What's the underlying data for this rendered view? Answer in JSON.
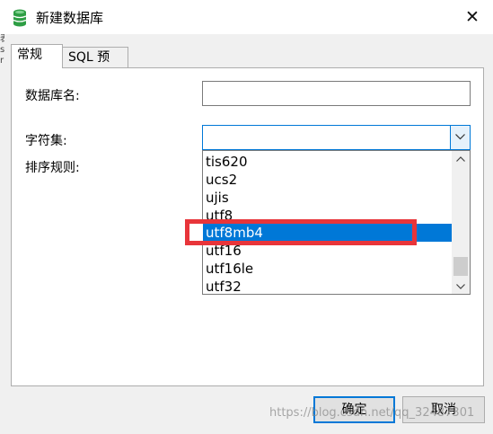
{
  "window": {
    "title": "新建数据库",
    "close_glyph": "✕"
  },
  "left_edge": {
    "chars": [
      "表",
      "s",
      "r"
    ]
  },
  "tabs": [
    {
      "label": "常规",
      "active": true
    },
    {
      "label": "SQL 预览",
      "active": false
    }
  ],
  "form": {
    "db_name_label": "数据库名:",
    "db_name_value": "",
    "charset_label": "字符集:",
    "charset_value": "",
    "collation_label": "排序规则:"
  },
  "charset_options": [
    {
      "label": "tis620",
      "selected": false
    },
    {
      "label": "ucs2",
      "selected": false
    },
    {
      "label": "ujis",
      "selected": false
    },
    {
      "label": "utf8",
      "selected": false
    },
    {
      "label": "utf8mb4",
      "selected": true
    },
    {
      "label": "utf16",
      "selected": false
    },
    {
      "label": "utf16le",
      "selected": false
    },
    {
      "label": "utf32",
      "selected": false
    }
  ],
  "buttons": {
    "ok": "确定",
    "cancel": "取消"
  },
  "watermark": "https://blog.csdn.net/qq_32487301",
  "colors": {
    "selection": "#0078d7",
    "highlight_annotation": "#e8353a",
    "db_icon": "#2e9e44"
  },
  "icons": {
    "app": "database-icon",
    "close": "close-icon",
    "dropdown": "chevron-down-icon"
  }
}
